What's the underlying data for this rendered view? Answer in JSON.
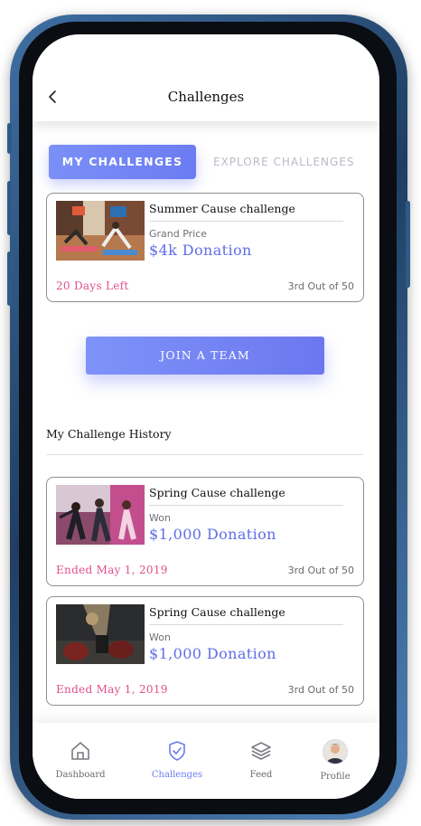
{
  "header": {
    "title": "Challenges"
  },
  "tabs": [
    {
      "label": "MY CHALLENGES",
      "active": true
    },
    {
      "label": "EXPLORE CHALLENGES",
      "active": false
    }
  ],
  "current_challenge": {
    "name": "Summer Cause challenge",
    "prize_label": "Grand Price",
    "prize_value": "$4k Donation",
    "status": "20 Days Left",
    "rank": "3rd Out of 50",
    "image": "yoga-class-photo"
  },
  "join_button": {
    "label": "JOIN A TEAM"
  },
  "history": {
    "title": "My Challenge History",
    "items": [
      {
        "name": "Spring Cause challenge",
        "prize_label": "Won",
        "prize_value": "$1,000 Donation",
        "status": "Ended May 1, 2019",
        "rank": "3rd Out of 50",
        "image": "dance-class-photo"
      },
      {
        "name": "Spring Cause challenge",
        "prize_label": "Won",
        "prize_value": "$1,000 Donation",
        "status": "Ended May 1, 2019",
        "rank": "3rd Out of 50",
        "image": "boxing-gloves-photo"
      }
    ]
  },
  "tabbar": {
    "items": [
      {
        "label": "Dashboard",
        "icon": "home-icon",
        "active": false
      },
      {
        "label": "Challenges",
        "icon": "shield-check-icon",
        "active": true
      },
      {
        "label": "Feed",
        "icon": "layers-icon",
        "active": false
      },
      {
        "label": "Profile",
        "icon": "avatar",
        "active": false
      }
    ]
  },
  "colors": {
    "accent": "#6b7cf2",
    "status": "#e0508a",
    "prize": "#5f6ee6",
    "frame": "#2f5a86"
  }
}
